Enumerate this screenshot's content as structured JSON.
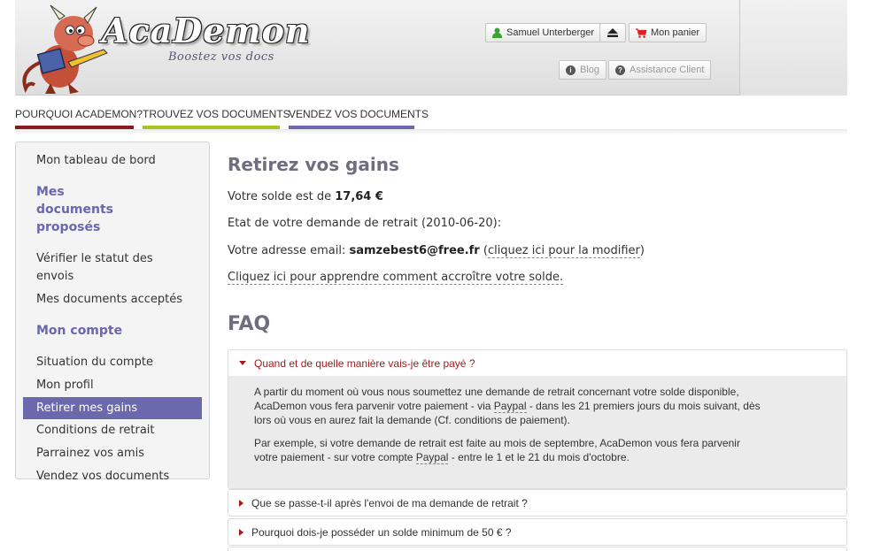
{
  "header": {
    "logo_text": "AcaDemon",
    "tagline": "Boostez vos docs",
    "user_button": "Samuel Unterberger",
    "cart_button": "Mon panier",
    "blog_button": "Blog",
    "support_button": "Assistance Client"
  },
  "topnav": [
    {
      "label": "POURQUOI ACADEMON?",
      "color": "#8b1a1a"
    },
    {
      "label": "TROUVEZ VOS DOCUMENTS",
      "color": "#a9c41f"
    },
    {
      "label": "VENDEZ VOS DOCUMENTS",
      "color": "#6b68ad"
    }
  ],
  "sidebar": {
    "dashboard": "Mon tableau de bord",
    "section_docs": "Mes documents proposés",
    "verify_line1": "Vérifier le statut des",
    "verify_line2": "envois",
    "accepted": "Mes documents acceptés",
    "section_account": "Mon compte",
    "account_status": "Situation du compte",
    "profile": "Mon profil",
    "withdraw": "Retirer mes gains",
    "conditions": "Conditions de retrait",
    "referral": "Parrainez vos amis",
    "sell": "Vendez vos documents"
  },
  "main": {
    "title": "Retirez vos gains",
    "balance_prefix": "Votre solde est de ",
    "balance_value": "17,64 €",
    "request_state": "Etat de votre demande de retrait (2010-06-20):",
    "email_prefix": "Votre adresse email: ",
    "email_value": "samzebest6@free.fr",
    "email_open_paren": " (",
    "email_link": "cliquez ici pour la modifier",
    "email_close_paren": ")",
    "increase_link": "Cliquez ici pour apprendre comment accroître votre solde."
  },
  "faq": {
    "title": "FAQ",
    "q1": "Quand et de quelle manière vais-je être payé ?",
    "a1_p1_a": "A partir du moment où vous nous soumettez une demande de retrait concernant votre solde disponible,",
    "a1_p1_b1": "AcaDemon vous fera parvenir votre paiement - via ",
    "a1_p1_paypal": "Paypal",
    "a1_p1_b2": " - dans les 21 premiers jours du mois suivant, dès",
    "a1_p1_c": "lors où vous en aurez fait la demande (Cf. conditions de paiement).",
    "a1_p2_a": "Par exemple, si votre demande de retrait est faite au mois de septembre, AcaDemon vous fera parvenir",
    "a1_p2_b1": "votre paiement - sur votre compte ",
    "a1_p2_paypal": "Paypal",
    "a1_p2_b2": " - entre le 1 et le 21 du mois d'octobre.",
    "q2": "Que se passe-t-il après l'envoi de ma demande de retrait ?",
    "q3": "Pourquoi dois-je posséder un solde minimum de 50 € ?"
  },
  "colors": {
    "accent_purple": "#6b68ad",
    "faq_red": "#a11b1b"
  }
}
